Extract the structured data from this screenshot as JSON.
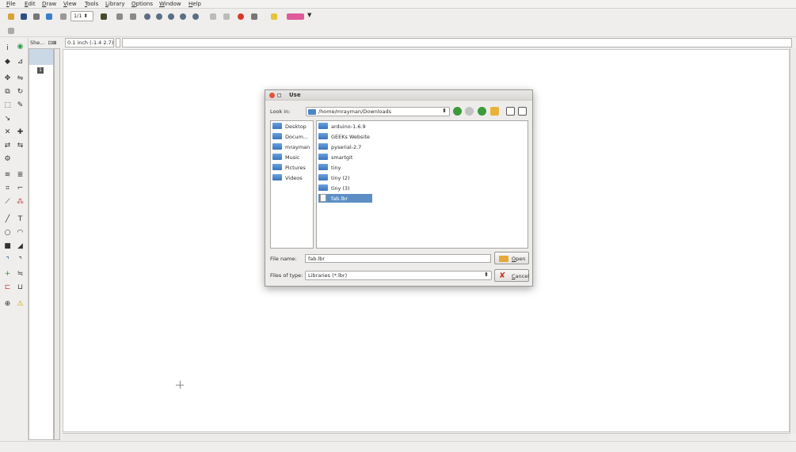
{
  "menu": [
    "File",
    "Edit",
    "Draw",
    "View",
    "Tools",
    "Library",
    "Options",
    "Window",
    "Help"
  ],
  "toolbar": {
    "zoom_select": "1/1"
  },
  "sheets_panel": {
    "label": "She...",
    "sheet_number": "1"
  },
  "coordinates": "0.1 inch (-1.4 2.7)",
  "dialog": {
    "title": "Use",
    "look_in_label": "Look in:",
    "look_in_path": "/home/mrayman/Downloads",
    "places": [
      "Desktop",
      "Docum...",
      "mrayman",
      "Music",
      "Pictures",
      "Videos"
    ],
    "files": [
      {
        "name": "arduino-1.6.9",
        "type": "folder"
      },
      {
        "name": "GEEKs Website",
        "type": "folder"
      },
      {
        "name": "pyserial-2.7",
        "type": "folder"
      },
      {
        "name": "smartgit",
        "type": "folder"
      },
      {
        "name": "tiny",
        "type": "folder"
      },
      {
        "name": "tiny (2)",
        "type": "folder"
      },
      {
        "name": "tiny (3)",
        "type": "folder"
      },
      {
        "name": "fab.lbr",
        "type": "file",
        "selected": true
      }
    ],
    "file_name_label": "File name:",
    "file_name_value": "fab.lbr",
    "file_type_label": "Files of type:",
    "file_type_value": "Libraries (*.lbr)",
    "open_button": "Open",
    "cancel_button": "Cancel"
  },
  "colors": {
    "selection": "#5d8fc6",
    "folder_blue": "#3a74bd",
    "close_red": "#e0533a"
  }
}
